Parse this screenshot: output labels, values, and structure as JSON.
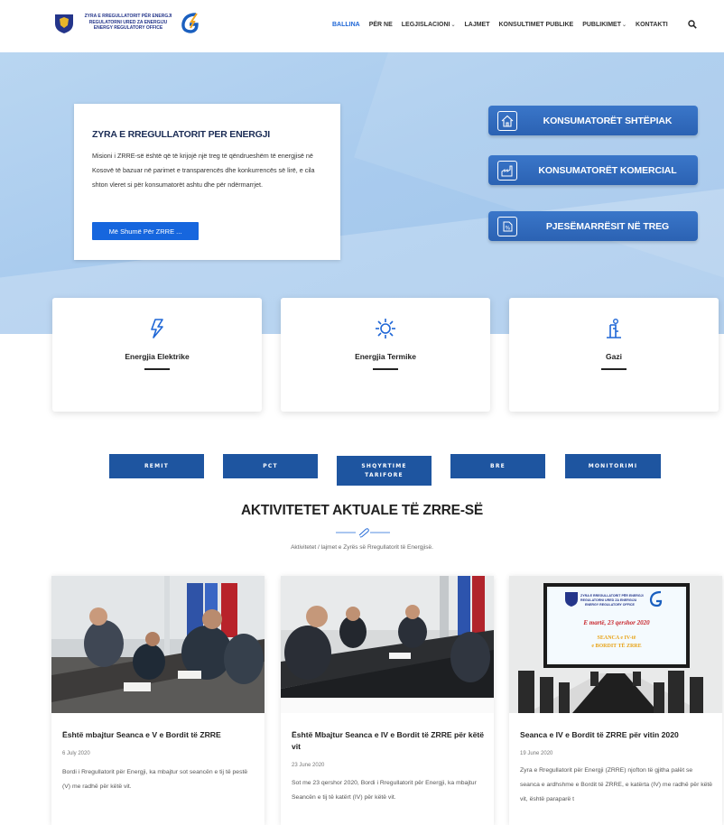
{
  "logo": {
    "line1": "ZYRA E RREGULLATORIT PËR ENERGJI",
    "line2": "REGULATORNI URED ZA ENERGIJU",
    "line3": "ENERGY REGULATORY OFFICE"
  },
  "nav": [
    {
      "label": "BALLINA",
      "active": true,
      "dropdown": false
    },
    {
      "label": "PËR NE",
      "active": false,
      "dropdown": false
    },
    {
      "label": "LEGJISLACIONI",
      "active": false,
      "dropdown": true
    },
    {
      "label": "LAJMET",
      "active": false,
      "dropdown": false
    },
    {
      "label": "KONSULTIMET PUBLIKE",
      "active": false,
      "dropdown": false
    },
    {
      "label": "PUBLIKIMET",
      "active": false,
      "dropdown": true
    },
    {
      "label": "KONTAKTI",
      "active": false,
      "dropdown": false
    }
  ],
  "hero": {
    "title": "ZYRA E RREGULLATORIT PER ENERGJI",
    "text": "Misioni i ZRRE-së është që të krijojë një treg të qëndrueshëm të energjisë në Kosovë të bazuar në parimet e transparencës dhe konkurrencës së lirë, e cila shton vleret si për konsumatorët ashtu dhe për ndërmarrjet.",
    "button": "Më Shumë Për ZRRE ..."
  },
  "consumer_buttons": [
    {
      "label": "KONSUMATORËT SHTËPIAK",
      "icon": "house-icon"
    },
    {
      "label": "KONSUMATORËT KOMERCIAL",
      "icon": "factory-icon"
    },
    {
      "label": "PJESËMARRËSIT NË TREG",
      "icon": "percent-tag-icon"
    }
  ],
  "energy_cards": [
    {
      "label": "Energjia Elektrike",
      "icon": "lightning-icon"
    },
    {
      "label": "Energjia Termike",
      "icon": "sun-icon"
    },
    {
      "label": "Gazi",
      "icon": "gas-icon"
    }
  ],
  "tabs": [
    "REMIT",
    "PCT",
    "SHQYRTIME TARIFORE",
    "BRE",
    "MONITORIMI"
  ],
  "section": {
    "title": "AKTIVITETET AKTUALE TË ZRRE-SË",
    "subtitle": "Aktivitetet / lajmet e Zyrës së Rregullatorit të Energjisë."
  },
  "news": [
    {
      "title": "Është mbajtur Seanca e V e Bordit të ZRRE",
      "date": "6 July 2020",
      "text": "Bordi i Rregullatorit për Energji, ka mbajtur sot seancën e tij të pestë (V) me radhë për këtë vit."
    },
    {
      "title": "Është Mbajtur Seanca e IV e Bordit të ZRRE për këtë vit",
      "date": "23 June 2020",
      "text": "Sot me 23 qershor 2020, Bordi i Rregullatorit për Energji, ka mbajtur Seancën e tij të katërt (IV) për këtë vit."
    },
    {
      "title": "Seanca e IV e Bordit të ZRRE për vitin 2020",
      "date": "19 June 2020",
      "text": "Zyra e Rregullatorit për Energji (ZRRE) njofton të gjitha palët se seanca e ardhshme e Bordit të ZRRE, e katërta (IV) me radhë për këtë vit, është paraparë t"
    }
  ],
  "news3_image": {
    "line1": "ZYRA E RREGULLATORIT PËR ENERGJI",
    "line2": "REGULATORNI URED ZA ENERGIJU",
    "line3": "ENERGY REGULATORY OFFICE",
    "date": "E martë, 23 qershor 2020",
    "session1": "SEANCA e IV-të",
    "session2": "e BORDIT TË ZRRE"
  },
  "colors": {
    "accent": "#1666de",
    "tab_bg": "#1e55a0",
    "consumer_btn": "#3068bb",
    "hero_bg": "#aac9ec"
  }
}
